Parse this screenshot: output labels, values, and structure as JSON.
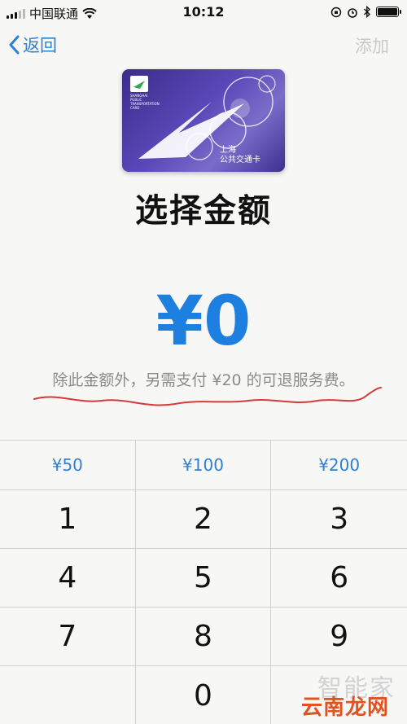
{
  "status_bar": {
    "carrier": "中国联通",
    "time": "10:12"
  },
  "nav": {
    "back_label": "返回",
    "add_label": "添加"
  },
  "card": {
    "brand_lines": [
      "SHANGHAI",
      "PUBLIC",
      "TRANSPORTATION",
      "CARD"
    ],
    "name_line1": "上海",
    "name_line2": "公共交通卡"
  },
  "page": {
    "title": "选择金额",
    "amount": "¥0",
    "note": "除此金额外，另需支付 ¥20 的可退服务费。"
  },
  "keypad": {
    "presets": [
      "¥50",
      "¥100",
      "¥200"
    ],
    "rows": [
      [
        "1",
        "2",
        "3"
      ],
      [
        "4",
        "5",
        "6"
      ],
      [
        "7",
        "8",
        "9"
      ],
      [
        "",
        "0",
        ""
      ]
    ]
  },
  "watermarks": {
    "line1": "智能家",
    "line2": "云南龙网"
  },
  "colors": {
    "accent": "#2f7fd6",
    "amount": "#1d7fe0",
    "annotation": "#d63a3a"
  }
}
